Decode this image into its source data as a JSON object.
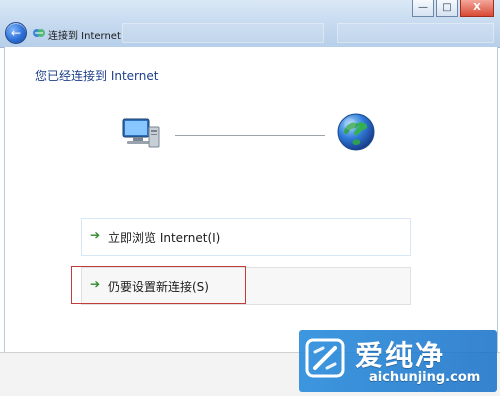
{
  "window": {
    "nav_title": "连接到 Internet",
    "controls": {
      "minimize": "—",
      "maximize": "□",
      "close": "X"
    }
  },
  "content": {
    "heading": "您已经连接到 Internet",
    "options": [
      {
        "label": "立即浏览 Internet(I)"
      },
      {
        "label": "仍要设置新连接(S)"
      }
    ]
  },
  "watermark": {
    "chinese": "爱纯净",
    "url": "aichunjing.com"
  },
  "colors": {
    "link_arrow": "#2e8b2e",
    "heading_text": "#1d3f8a",
    "highlight_outline": "#c43b3b",
    "watermark": "#1e7fd1"
  },
  "icons": {
    "back": "back-arrow-icon",
    "network": "network-connection-icon",
    "computer": "computer-icon",
    "globe": "globe-icon",
    "arrow": "green-arrow-icon"
  }
}
